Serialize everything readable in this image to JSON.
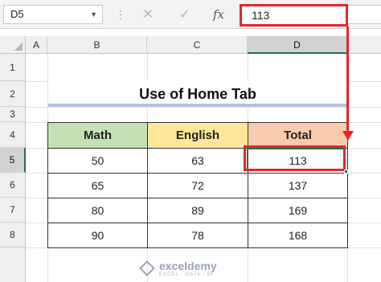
{
  "formula_bar": {
    "name_box": "D5",
    "cancel_icon": "close-icon",
    "enter_icon": "check-icon",
    "fx_label": "fx",
    "value": "113"
  },
  "columns": [
    "A",
    "B",
    "C",
    "D"
  ],
  "rows": [
    "1",
    "2",
    "3",
    "4",
    "5",
    "6",
    "7",
    "8"
  ],
  "selected_cell": {
    "column": "D",
    "row": "5"
  },
  "title": "Use of Home Tab",
  "table": {
    "headers": [
      "Math",
      "English",
      "Total"
    ],
    "rows": [
      [
        "50",
        "63",
        "113"
      ],
      [
        "65",
        "72",
        "137"
      ],
      [
        "80",
        "89",
        "169"
      ],
      [
        "90",
        "78",
        "168"
      ]
    ]
  },
  "colors": {
    "highlight": "#e0272d",
    "selection": "#217346",
    "math_header": "#c6e0b4",
    "english_header": "#ffe699",
    "total_header": "#f8cbad"
  },
  "watermark": {
    "name": "exceldemy",
    "tagline": "EXCEL · DATA · BI"
  }
}
